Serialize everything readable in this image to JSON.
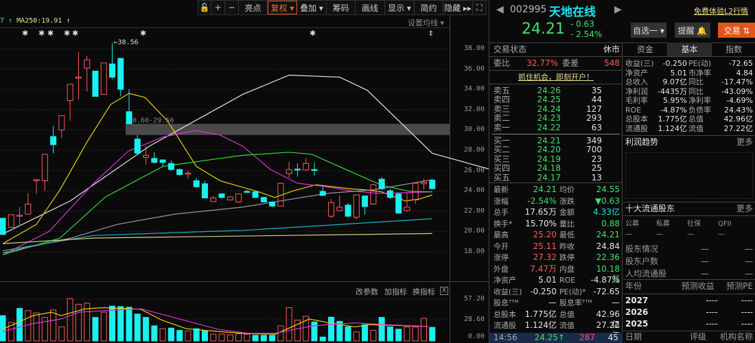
{
  "toolbar": {
    "items": [
      "+",
      "−",
      "亮点",
      "复权 ▾",
      "叠加 ▾",
      "筹码",
      "画线",
      "显示 ▾",
      "简约",
      "隐藏 ▸▸"
    ]
  },
  "legend": {
    "ma_prev": "7 ↑",
    "ma250": "MA250:19.91 ↑",
    "set_ma": "设置均线 ▾"
  },
  "price_axis": [
    "38.00",
    "36.00",
    "34.00",
    "32.00",
    "30.00",
    "28.00",
    "26.00",
    "24.00",
    "22.00",
    "20.00",
    "18.00"
  ],
  "vol_axis": [
    "57.20",
    "28.60",
    "0.00"
  ],
  "vol_header": {
    "edit": "改参数",
    "add": "加指标",
    "switch": "换指标",
    "close": "X"
  },
  "chart_data": {
    "type": "candlestick",
    "ylim": [
      18,
      38
    ],
    "high_label": "←38.56",
    "gap_label": "30.60-29.50",
    "gap": [
      29.5,
      30.6
    ],
    "up_color": "#ff5a5a",
    "down_color": "#19f0f0",
    "ohlc": [
      [
        21.3,
        21.3,
        19.7,
        19.7
      ],
      [
        20.4,
        21.65,
        20.4,
        21.65
      ],
      [
        21.5,
        22.4,
        20.5,
        21.6
      ],
      [
        21.7,
        23.8,
        21.7,
        22.7
      ],
      [
        25.0,
        25.1,
        23.7,
        25.1
      ],
      [
        25.0,
        27.6,
        24.0,
        27.6
      ],
      [
        29.35,
        30.4,
        27.7,
        28.55
      ],
      [
        30.0,
        31.4,
        29.2,
        31.4
      ],
      [
        32.9,
        34.5,
        30.9,
        34.5
      ],
      [
        35.1,
        37.7,
        33.0,
        35.2
      ],
      [
        36.1,
        37.3,
        33.8,
        36.9
      ],
      [
        35.8,
        35.8,
        33.3,
        33.3
      ],
      [
        33.5,
        36.6,
        33.5,
        36.6
      ],
      [
        36.5,
        38.56,
        35.0,
        35.2
      ],
      [
        37.05,
        37.05,
        33.3,
        34.0
      ],
      [
        31.8,
        34.0,
        30.6,
        30.6
      ],
      [
        29.1,
        29.5,
        27.7,
        27.7
      ],
      [
        27.3,
        28.4,
        26.6,
        27.5
      ],
      [
        27.2,
        27.8,
        26.7,
        26.8
      ],
      [
        27.05,
        27.1,
        26.4,
        26.8
      ],
      [
        26.7,
        27.0,
        26.0,
        26.1
      ],
      [
        26.1,
        26.2,
        25.5,
        25.6
      ],
      [
        25.65,
        26.0,
        25.2,
        25.75
      ],
      [
        25.0,
        25.3,
        24.3,
        24.4
      ],
      [
        24.7,
        25.0,
        23.3,
        23.3
      ],
      [
        22.95,
        23.5,
        22.9,
        23.3
      ],
      [
        23.7,
        23.8,
        23.2,
        23.35
      ],
      [
        23.1,
        23.5,
        23.1,
        23.4
      ],
      [
        22.9,
        23.7,
        22.8,
        23.7
      ],
      [
        23.95,
        24.1,
        23.8,
        23.85
      ],
      [
        23.9,
        24.0,
        23.3,
        23.35
      ],
      [
        23.35,
        23.4,
        22.9,
        22.9
      ],
      [
        22.9,
        23.0,
        22.4,
        22.5
      ],
      [
        22.5,
        24.8,
        22.45,
        24.75
      ],
      [
        25.7,
        26.85,
        25.3,
        26.1
      ],
      [
        26.15,
        26.7,
        25.4,
        26.05
      ],
      [
        26.05,
        27.2,
        26.0,
        26.7
      ],
      [
        26.1,
        26.8,
        25.5,
        26.0
      ],
      [
        23.95,
        24.5,
        23.5,
        23.55
      ],
      [
        21.5,
        23.2,
        21.3,
        22.85
      ],
      [
        22.05,
        23.55,
        22.0,
        22.4
      ],
      [
        22.6,
        22.8,
        21.4,
        21.5
      ],
      [
        21.4,
        23.6,
        21.2,
        23.6
      ],
      [
        23.5,
        23.5,
        21.65,
        22.45
      ],
      [
        22.7,
        24.7,
        22.6,
        24.6
      ],
      [
        25.15,
        25.35,
        24.1,
        24.2
      ],
      [
        24.0,
        24.2,
        23.2,
        23.35
      ],
      [
        23.7,
        23.8,
        21.8,
        21.8
      ],
      [
        22.05,
        23.8,
        21.95,
        22.4
      ],
      [
        23.1,
        24.8,
        22.7,
        24.75
      ],
      [
        24.7,
        25.2,
        24.15,
        24.85
      ],
      [
        25.05,
        25.2,
        24.21,
        24.21
      ]
    ],
    "ma_lines": [
      {
        "name": "MA5",
        "color": "#e6e6e6",
        "points": [
          [
            0,
            19.75
          ],
          [
            8,
            23.0
          ],
          [
            17.4,
            28.4
          ],
          [
            28.5,
            33.5
          ],
          [
            34,
            35.4
          ],
          [
            40,
            35.2
          ],
          [
            43.3,
            33.9
          ],
          [
            51,
            27.7
          ],
          [
            61,
            25.4
          ],
          [
            71,
            23.4
          ],
          [
            75.8,
            23.2
          ],
          [
            77.8,
            23.4
          ],
          [
            79.6,
            24.55
          ],
          [
            82.5,
            25.9
          ],
          [
            85.5,
            24.55
          ],
          [
            88,
            23.0
          ],
          [
            89.4,
            22.6
          ],
          [
            91,
            23.0
          ],
          [
            92.4,
            23.7
          ],
          [
            94.5,
            23.35
          ],
          [
            97.5,
            23.5
          ]
        ]
      },
      {
        "name": "MA10",
        "color": "#e8d400",
        "points": [
          [
            0,
            18.8
          ],
          [
            4,
            20.7
          ],
          [
            6.8,
            24.1
          ],
          [
            10,
            28.8
          ],
          [
            12.8,
            32.5
          ],
          [
            15,
            33.6
          ],
          [
            16.9,
            33.2
          ],
          [
            19.6,
            30.85
          ],
          [
            23,
            26.4
          ],
          [
            25.8,
            25.0
          ],
          [
            28.5,
            24.35
          ],
          [
            30.4,
            23.9
          ],
          [
            32.3,
            23.35
          ],
          [
            34.5,
            24.0
          ],
          [
            37.2,
            24.6
          ],
          [
            41.3,
            24.2
          ],
          [
            43,
            24.1
          ],
          [
            45,
            23.9
          ],
          [
            47.8,
            23.0
          ],
          [
            49.5,
            23.2
          ],
          [
            51,
            23.6
          ]
        ]
      },
      {
        "name": "MA20",
        "color": "#e030e0",
        "points": [
          [
            0,
            17.7
          ],
          [
            5.5,
            20.0
          ],
          [
            10.8,
            24.75
          ],
          [
            14.9,
            27.9
          ],
          [
            19,
            29.3
          ],
          [
            23,
            29.95
          ],
          [
            25.8,
            29.5
          ],
          [
            28.5,
            28.4
          ],
          [
            31.8,
            26.1
          ],
          [
            35,
            24.75
          ],
          [
            38.5,
            24.4
          ],
          [
            41.3,
            24.0
          ],
          [
            44.6,
            23.75
          ],
          [
            51,
            23.9
          ]
        ]
      },
      {
        "name": "MA30",
        "color": "#30e030",
        "points": [
          [
            0,
            17.7
          ],
          [
            6.8,
            19.35
          ],
          [
            12.2,
            23.4
          ],
          [
            19,
            26.4
          ],
          [
            24.5,
            27.05
          ],
          [
            28.5,
            27.5
          ],
          [
            34,
            27.8
          ],
          [
            36.7,
            27.6
          ],
          [
            41.3,
            25.9
          ],
          [
            45,
            24.55
          ],
          [
            48.3,
            23.95
          ],
          [
            51,
            23.9
          ]
        ]
      },
      {
        "name": "MA60",
        "color": "#9a9a9a",
        "points": [
          [
            0,
            17.9
          ],
          [
            8.1,
            19.35
          ],
          [
            13.6,
            20.7
          ],
          [
            20.4,
            21.7
          ],
          [
            28.5,
            22.4
          ],
          [
            38.5,
            23.75
          ],
          [
            44,
            24.1
          ],
          [
            51,
            25.1
          ]
        ]
      },
      {
        "name": "MA120",
        "color": "#19b8c8",
        "points": [
          [
            0,
            18.1
          ],
          [
            10.8,
            19.6
          ],
          [
            24.5,
            20.0
          ],
          [
            28.5,
            20.1
          ],
          [
            51,
            21.25
          ]
        ]
      },
      {
        "name": "MA250",
        "color": "#d8d088",
        "points": [
          [
            0,
            18.8
          ],
          [
            10.8,
            19.35
          ],
          [
            28.5,
            19.55
          ],
          [
            51,
            19.8
          ]
        ]
      }
    ],
    "volume": {
      "ylim": [
        0,
        57.2
      ],
      "values": [
        34.6,
        25.4,
        44.5,
        41.4,
        38.3,
        32.2,
        42.4,
        19.2,
        57.8,
        50.1,
        51.6,
        32.2,
        39.3,
        47.6,
        47.0,
        46.1,
        36.8,
        32.2,
        20.7,
        16.7,
        17.6,
        14.5,
        13.6,
        16.7,
        13.9,
        9.3,
        9.3,
        8.3,
        9.9,
        9.3,
        7.7,
        7.7,
        7.7,
        20.7,
        45.5,
        28.4,
        33.7,
        26.0,
        5.3,
        32.5,
        26.9,
        19.2,
        12.4,
        22.3,
        14.5,
        32.2,
        19.2,
        16.1,
        19.2,
        19.2,
        30.9,
        18.6
      ],
      "up": [
        0,
        1,
        0,
        1,
        1,
        1,
        1,
        1,
        1,
        1,
        1,
        0,
        1,
        0,
        0,
        0,
        0,
        0,
        0,
        1,
        0,
        0,
        1,
        0,
        0,
        1,
        1,
        1,
        1,
        1,
        0,
        0,
        0,
        1,
        1,
        1,
        1,
        0,
        0,
        0,
        0,
        0,
        1,
        0,
        1,
        0,
        0,
        0,
        1,
        1,
        1,
        0
      ],
      "ma_lines": [
        {
          "color": "#e8d400",
          "points": [
            [
              0,
              16.1
            ],
            [
              3.6,
              34.6
            ],
            [
              5.8,
              39.3
            ],
            [
              6.9,
              34.6
            ],
            [
              9.8,
              43.9
            ],
            [
              12,
              45.5
            ],
            [
              16.4,
              43.3
            ],
            [
              18.9,
              28.4
            ],
            [
              21.8,
              16.7
            ],
            [
              25.5,
              13.0
            ],
            [
              29.1,
              9.9
            ],
            [
              32.4,
              9.3
            ],
            [
              36.4,
              30.0
            ],
            [
              38.5,
              25.4
            ],
            [
              41.8,
              19.2
            ],
            [
              43.6,
              22.3
            ],
            [
              50.5,
              19.8
            ]
          ]
        },
        {
          "color": "#e030e0",
          "points": [
            [
              0,
              13.0
            ],
            [
              3.6,
              23.8
            ],
            [
              6.9,
              29.9
            ],
            [
              9.1,
              39.3
            ],
            [
              12,
              41.4
            ],
            [
              16.4,
              43.9
            ],
            [
              20,
              33.1
            ],
            [
              25.5,
              16.1
            ],
            [
              29.1,
              10.5
            ],
            [
              32.4,
              10.5
            ],
            [
              36.4,
              19.8
            ],
            [
              38.5,
              22.3
            ],
            [
              41.8,
              24.7
            ],
            [
              45.5,
              22.3
            ],
            [
              50.5,
              19.8
            ]
          ]
        }
      ]
    }
  },
  "quote": {
    "code": "002995",
    "name": "天地在线",
    "l2_link": "免费体验L2行情",
    "price": "24.21",
    "change": "- 0.63",
    "pct": "- 2.54%",
    "watch_btn": "自选一 ▾",
    "alert_btn": "提醒 🔔",
    "trade_btn": "交易 ⇅"
  },
  "status": {
    "label": "交易状态",
    "value": "休市",
    "ratio_label": "委比",
    "ratio": "32.77%",
    "diff_label": "委差",
    "diff": "548",
    "promo": "抓住机会，即刻开户！"
  },
  "asks": [
    {
      "label": "卖五",
      "price": "24.26",
      "vol": "35"
    },
    {
      "label": "卖四",
      "price": "24.25",
      "vol": "44"
    },
    {
      "label": "卖三",
      "price": "24.24",
      "vol": "127"
    },
    {
      "label": "卖二",
      "price": "24.23",
      "vol": "293"
    },
    {
      "label": "卖一",
      "price": "24.22",
      "vol": "63"
    }
  ],
  "bids": [
    {
      "label": "买一",
      "price": "24.21",
      "vol": "349"
    },
    {
      "label": "买二",
      "price": "24.20",
      "vol": "700"
    },
    {
      "label": "买三",
      "price": "24.19",
      "vol": "23"
    },
    {
      "label": "买四",
      "price": "24.18",
      "vol": "25"
    },
    {
      "label": "买五",
      "price": "24.17",
      "vol": "13"
    }
  ],
  "stats": [
    {
      "l1": "最新",
      "v1": "24.21",
      "c1": "green",
      "l2": "均价",
      "v2": "24.55",
      "c2": "green"
    },
    {
      "l1": "涨幅",
      "v1": "-2.54%",
      "c1": "green",
      "l2": "涨跌",
      "v2": "▼0.63",
      "c2": "green"
    },
    {
      "l1": "总手",
      "v1": "17.65万",
      "c1": "white",
      "l2": "金额",
      "v2": "4.33亿",
      "c2": "cyan"
    },
    {
      "l1": "换手*",
      "v1": "15.70%",
      "c1": "white",
      "l2": "量比",
      "v2": "0.88",
      "c2": "green"
    },
    {
      "l1": "最高",
      "v1": "25.20",
      "c1": "red",
      "l2": "最低",
      "v2": "24.21",
      "c2": "green"
    },
    {
      "l1": "今开",
      "v1": "25.11",
      "c1": "red",
      "l2": "昨收",
      "v2": "24.84",
      "c2": "white"
    },
    {
      "l1": "涨停",
      "v1": "27.32",
      "c1": "red",
      "l2": "跌停",
      "v2": "22.36",
      "c2": "green"
    },
    {
      "l1": "外盘",
      "v1": "7.47万",
      "c1": "red",
      "l2": "内盘",
      "v2": "10.18万",
      "c2": "green"
    },
    {
      "l1": "净资产",
      "v1": "5.01",
      "c1": "white",
      "l2": "ROE",
      "v2": "-4.87%",
      "c2": "white"
    },
    {
      "l1": "收益(三)",
      "v1": "-0.250",
      "c1": "white",
      "l2": "PE(动)*",
      "v2": "-72.65",
      "c2": "white"
    },
    {
      "l1": "股息ᵀᵀᴹ",
      "v1": "—",
      "c1": "white",
      "l2": "股息率ᵀᵀᴹ",
      "v2": "—",
      "c2": "white"
    },
    {
      "l1": "总股本",
      "v1": "1.775亿",
      "c1": "white",
      "l2": "总值",
      "v2": "42.96亿",
      "c2": "white"
    },
    {
      "l1": "流通股",
      "v1": "1.124亿",
      "c1": "white",
      "l2": "流值",
      "v2": "27.22亿",
      "c2": "white"
    }
  ],
  "tick": {
    "time": "14:56",
    "price": "24.25↑",
    "vol": "287",
    "count": "45"
  },
  "tabs": [
    "资金",
    "基本",
    "指数"
  ],
  "fund": [
    {
      "l1": "收益(三)",
      "v1": "-0.250",
      "l2": "PE(动)",
      "v2": "-72.65"
    },
    {
      "l1": "净资产",
      "v1": "5.01",
      "l2": "市净率",
      "v2": "4.84"
    },
    {
      "l1": "总收入",
      "v1": "9.07亿",
      "l2": "同比",
      "v2": "-17.47%"
    },
    {
      "l1": "净利润",
      "v1": "-4435万",
      "l2": "同比",
      "v2": "-43.09%"
    },
    {
      "l1": "毛利率",
      "v1": "5.95%",
      "l2": "净利率",
      "v2": "-4.69%"
    },
    {
      "l1": "ROE",
      "v1": "-4.87%",
      "l2": "负债率",
      "v2": "24.43%"
    },
    {
      "l1": "总股本",
      "v1": "1.775亿",
      "l2": "总值",
      "v2": "42.96亿"
    },
    {
      "l1": "流通股",
      "v1": "1.124亿",
      "l2": "流值",
      "v2": "27.22亿"
    }
  ],
  "profit": {
    "title": "利润趋势",
    "more": "更多"
  },
  "holders": {
    "title": "十大流通股东",
    "more": "更多",
    "cats": [
      "公募",
      "私募",
      "社保",
      "QFII"
    ],
    "dash": "—",
    "rows": [
      {
        "label": "股东情况",
        "a": "—",
        "b": "—"
      },
      {
        "label": "股东户数",
        "a": "—",
        "b": "—"
      },
      {
        "label": "人均流通股",
        "a": "—",
        "b": "—"
      }
    ]
  },
  "forecast": {
    "headers": [
      "年份",
      "预测收益",
      "预测PE"
    ],
    "rows": [
      {
        "year": "2027",
        "eps": "----",
        "pe": "----"
      },
      {
        "year": "2026",
        "eps": "----",
        "pe": "----"
      },
      {
        "year": "2025",
        "eps": "----",
        "pe": "----"
      }
    ]
  },
  "rating": {
    "headers": [
      "日期",
      "评级",
      "机构名称"
    ]
  }
}
